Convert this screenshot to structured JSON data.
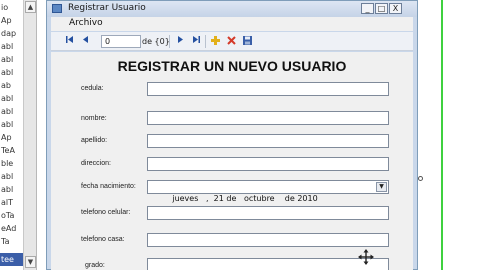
{
  "background_list": {
    "items": [
      "io",
      "Ap",
      "dap",
      "abl",
      "abl",
      "abl",
      "ab",
      "abl",
      "abl",
      "abl",
      "Ap",
      "TeA",
      "ble",
      "abl",
      "abl",
      "alT",
      "oTa",
      "eAd",
      "Ta",
      "tee"
    ],
    "selected_index": 19
  },
  "window": {
    "title": "Registrar Usuario",
    "controls": {
      "minimize": "_",
      "maximize": "□",
      "close": "X"
    }
  },
  "menu": {
    "items": [
      "Archivo"
    ]
  },
  "toolbar": {
    "position_value": "0",
    "count_text": "de {0}"
  },
  "form": {
    "title": "REGISTRAR UN NUEVO USUARIO",
    "fields": [
      {
        "label": "cedula:",
        "value": ""
      },
      {
        "label": "nombre:",
        "value": ""
      },
      {
        "label": "apellido:",
        "value": ""
      },
      {
        "label": "direccion:",
        "value": ""
      },
      {
        "label": "fecha nacimiento:",
        "value": "jueves   ,  21 de   octubre    de 2010"
      },
      {
        "label": "telefono celular:",
        "value": ""
      },
      {
        "label": "telefono casa:",
        "value": ""
      },
      {
        "label": "grado:",
        "value": ""
      }
    ]
  },
  "colors": {
    "accent": "#3fd13f",
    "title_bar": "#c9d7ea",
    "selection": "#3b5ea8"
  }
}
